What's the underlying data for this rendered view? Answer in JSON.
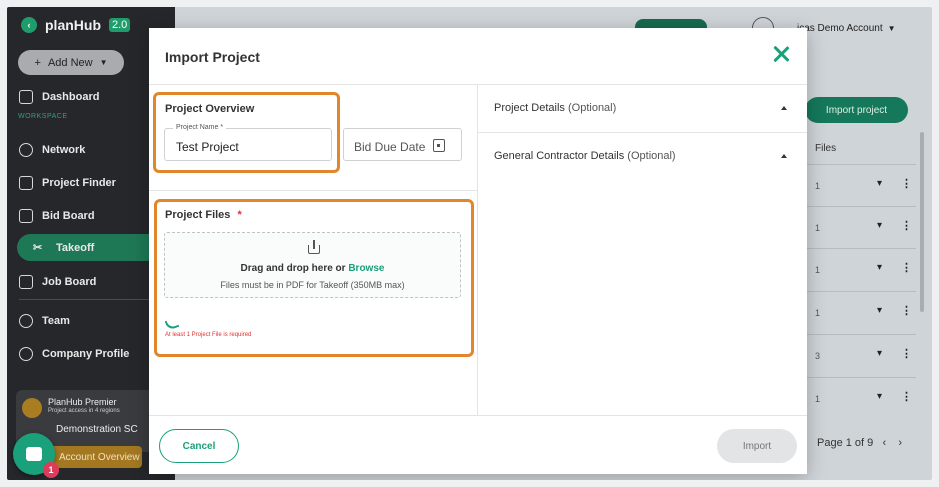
{
  "sidebar": {
    "logo": "planHub",
    "version": "2.0",
    "add_new": "Add New",
    "workspace_label": "WORKSPACE",
    "items": [
      {
        "label": "Dashboard"
      },
      {
        "label": "Network"
      },
      {
        "label": "Project Finder"
      },
      {
        "label": "Bid Board"
      },
      {
        "label": "Takeoff"
      },
      {
        "label": "Job Board"
      },
      {
        "label": "Team"
      },
      {
        "label": "Company Profile"
      }
    ],
    "premier": {
      "title": "PlanHub Premier",
      "subtitle": "Project access in 4 regions",
      "company": "Demonstration SC",
      "account_overview": "Account Overview"
    },
    "chat_badge": "1"
  },
  "background": {
    "account": "icas Demo Account",
    "import_button": "Import project",
    "files_header": "Files",
    "file_counts": [
      "1",
      "1",
      "1",
      "1",
      "3",
      "1"
    ],
    "pager": "Page 1 of 9"
  },
  "modal": {
    "title": "Import Project",
    "overview_title": "Project Overview",
    "project_name_label": "Project Name *",
    "project_name_value": "Test Project",
    "bid_due_placeholder": "Bid Due Date",
    "files_title": "Project Files",
    "files_required_mark": "*",
    "drop_text": "Drag and drop here or",
    "browse": "Browse",
    "drop_hint": "Files must be in PDF for Takeoff (350MB max)",
    "error": "At least 1 Project File is required",
    "project_details": "Project Details",
    "gc_details": "General Contractor Details",
    "optional": "(Optional)",
    "cancel": "Cancel",
    "import": "Import"
  },
  "colors": {
    "accent": "#1aa07a",
    "highlight": "#e0872e",
    "error": "#dd3333"
  }
}
